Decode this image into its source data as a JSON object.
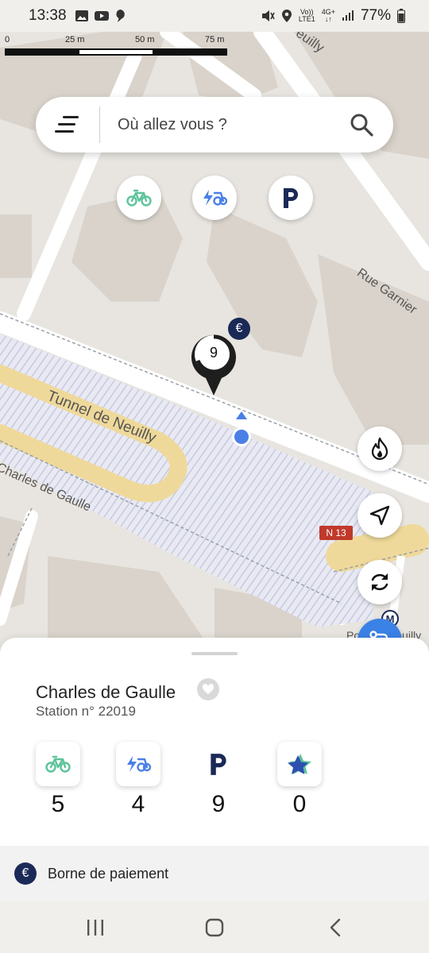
{
  "status_bar": {
    "time": "13:38",
    "network_top": "Vo))",
    "network_bottom": "LTE1",
    "net_type": "4G+",
    "battery": "77%"
  },
  "map": {
    "scale_labels": [
      "0",
      "25 m",
      "50 m",
      "75 m"
    ],
    "street_labels": {
      "rue_garnier": "Rue Garnier",
      "tunnel": "Tunnel de Neuilly",
      "charles": "Charles de Gaulle",
      "neuilly_top": "euilly",
      "metro_label": "Pont de Neuilly",
      "road_sign": "N 13"
    },
    "marker_count": "9",
    "euro_symbol": "€",
    "metro_symbol": "M"
  },
  "search": {
    "placeholder": "Où allez vous ?"
  },
  "filters": [
    "bike-icon",
    "ebike-icon",
    "parking-icon"
  ],
  "fabs": [
    "fire-icon",
    "locate-arrow-icon",
    "refresh-icon",
    "route-icon"
  ],
  "station": {
    "name": "Charles de Gaulle",
    "number": "Station n° 22019",
    "stats": [
      {
        "icon": "bike-icon",
        "value": "5"
      },
      {
        "icon": "ebike-icon",
        "value": "4"
      },
      {
        "icon": "parking-icon",
        "value": "9"
      },
      {
        "icon": "star-icon",
        "value": "0"
      }
    ]
  },
  "payment": {
    "symbol": "€",
    "label": "Borne de paiement"
  },
  "colors": {
    "bike_green": "#5cc39a",
    "ebike_blue": "#4a7fe6",
    "navy": "#1a2956",
    "fab_blue": "#3b82e6"
  }
}
